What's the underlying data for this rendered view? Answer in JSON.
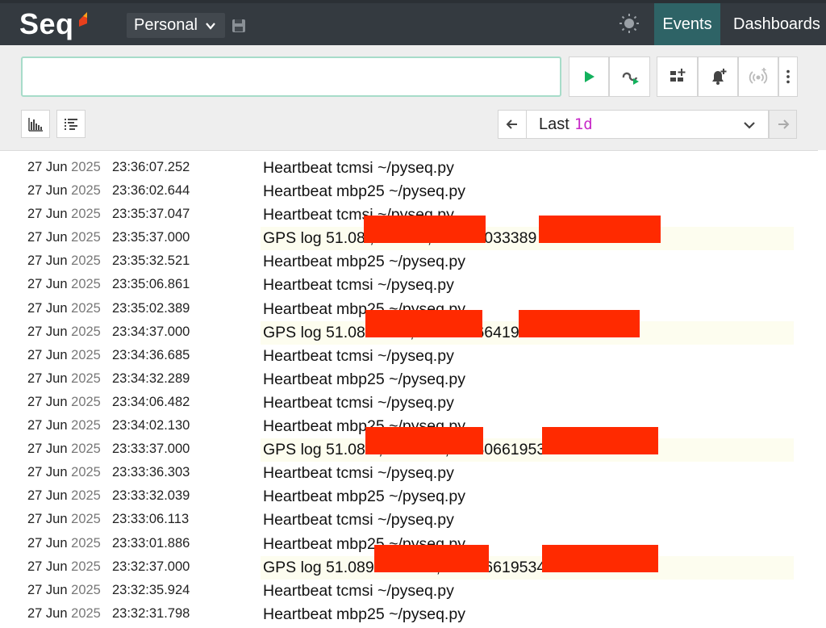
{
  "app": {
    "brand": "Seq",
    "workspace": "Personal",
    "nav": {
      "events": "Events",
      "dashboards": "Dashboards"
    },
    "colors": {
      "topbar": "#343a40",
      "active_nav": "#2e6366",
      "run": "#13b15d",
      "range_accent": "#c728c7",
      "redaction": "#ff2a00"
    }
  },
  "query": {
    "placeholder": "",
    "value": ""
  },
  "toolbar": {
    "icons": [
      "play-icon",
      "tail-icon",
      "add-signal-icon",
      "alert-icon",
      "broadcast-icon",
      "kebab-icon"
    ]
  },
  "range": {
    "label": "Last",
    "value": "1d"
  },
  "events": [
    {
      "day": "27 Jun",
      "year": "2025",
      "time": "23:36:07.252",
      "message": "Heartbeat tcmsi ~/pyseq.py",
      "kind": "heartbeat"
    },
    {
      "day": "27 Jun",
      "year": "2025",
      "time": "23:36:02.644",
      "message": "Heartbeat mbp25 ~/pyseq.py",
      "kind": "heartbeat"
    },
    {
      "day": "27 Jun",
      "year": "2025",
      "time": "23:35:37.047",
      "message": "Heartbeat tcmsi ~/pyseq.py",
      "kind": "heartbeat"
    },
    {
      "day": "27 Jun",
      "year": "2025",
      "time": "23:35:37.000",
      "message": "GPS log 51.08                                    , -1.164                                   , 10.893033389…",
      "kind": "gps"
    },
    {
      "day": "27 Jun",
      "year": "2025",
      "time": "23:35:32.521",
      "message": "Heartbeat mbp25 ~/pyseq.py",
      "kind": "heartbeat"
    },
    {
      "day": "27 Jun",
      "year": "2025",
      "time": "23:35:06.861",
      "message": "Heartbeat tcmsi ~/pyseq.py",
      "kind": "heartbeat"
    },
    {
      "day": "27 Jun",
      "year": "2025",
      "time": "23:35:02.389",
      "message": "Heartbeat mbp25 ~/pyseq.py",
      "kind": "heartbeat"
    },
    {
      "day": "27 Jun",
      "year": "2025",
      "time": "23:34:37.000",
      "message": "GPS log 51.08                                  -1.16                                   , 12.97726641987…",
      "kind": "gps"
    },
    {
      "day": "27 Jun",
      "year": "2025",
      "time": "23:34:36.685",
      "message": "Heartbeat tcmsi ~/pyseq.py",
      "kind": "heartbeat"
    },
    {
      "day": "27 Jun",
      "year": "2025",
      "time": "23:34:32.289",
      "message": "Heartbeat mbp25 ~/pyseq.py",
      "kind": "heartbeat"
    },
    {
      "day": "27 Jun",
      "year": "2025",
      "time": "23:34:06.482",
      "message": "Heartbeat tcmsi ~/pyseq.py",
      "kind": "heartbeat"
    },
    {
      "day": "27 Jun",
      "year": "2025",
      "time": "23:34:02.130",
      "message": "Heartbeat mbp25 ~/pyseq.py",
      "kind": "heartbeat"
    },
    {
      "day": "27 Jun",
      "year": "2025",
      "time": "23:33:37.000",
      "message": "GPS log 51.08                                   5, -1.164                                 2, 14.806619534…",
      "kind": "gps"
    },
    {
      "day": "27 Jun",
      "year": "2025",
      "time": "23:33:36.303",
      "message": "Heartbeat tcmsi ~/pyseq.py",
      "kind": "heartbeat"
    },
    {
      "day": "27 Jun",
      "year": "2025",
      "time": "23:33:32.039",
      "message": "Heartbeat mbp25 ~/pyseq.py",
      "kind": "heartbeat"
    },
    {
      "day": "27 Jun",
      "year": "2025",
      "time": "23:33:06.113",
      "message": "Heartbeat tcmsi ~/pyseq.py",
      "kind": "heartbeat"
    },
    {
      "day": "27 Jun",
      "year": "2025",
      "time": "23:33:01.886",
      "message": "Heartbeat mbp25 ~/pyseq.py",
      "kind": "heartbeat"
    },
    {
      "day": "27 Jun",
      "year": "2025",
      "time": "23:32:37.000",
      "message": "GPS log 51.089                                   -1.164                                  2, 14.806619534…",
      "kind": "gps"
    },
    {
      "day": "27 Jun",
      "year": "2025",
      "time": "23:32:35.924",
      "message": "Heartbeat tcmsi ~/pyseq.py",
      "kind": "heartbeat"
    },
    {
      "day": "27 Jun",
      "year": "2025",
      "time": "23:32:31.798",
      "message": "Heartbeat mbp25 ~/pyseq.py",
      "kind": "heartbeat"
    }
  ]
}
